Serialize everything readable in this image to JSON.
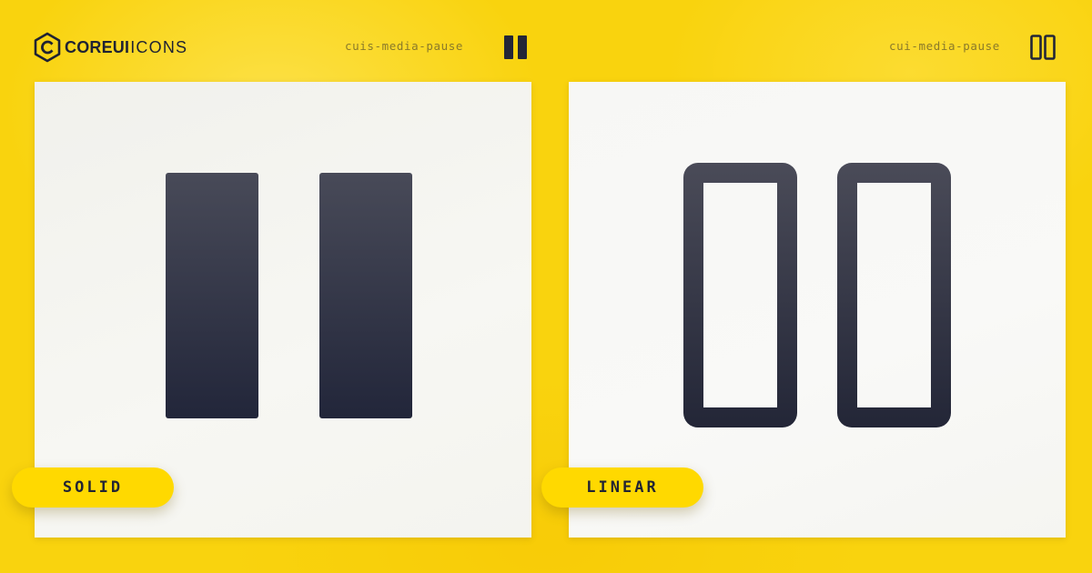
{
  "brand": {
    "name_bold": "COREUI",
    "name_light": "ICONS",
    "logo_icon": "coreui-hexagon-c-logo"
  },
  "colors": {
    "background": "#f9d30e",
    "panel": "#f6f6f2",
    "icon_dark": "#232637",
    "icon_light": "#4a4b58",
    "pill": "#ffd900"
  },
  "variants": [
    {
      "icon_name": "cuis-media-pause",
      "style_label": "SOLID",
      "icon": "media-pause-solid-icon"
    },
    {
      "icon_name": "cui-media-pause",
      "style_label": "LINEAR",
      "icon": "media-pause-linear-icon"
    }
  ]
}
